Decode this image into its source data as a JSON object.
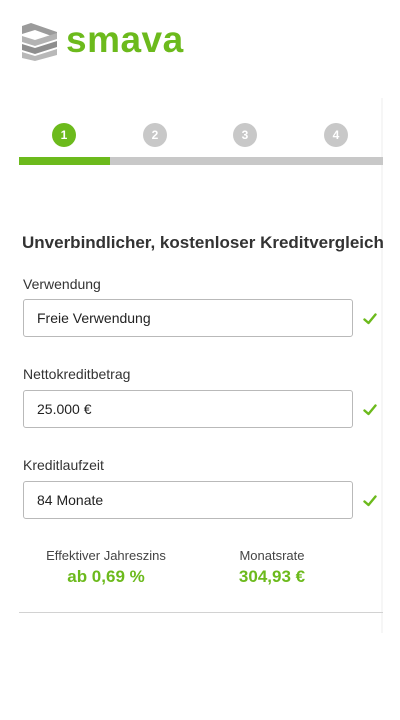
{
  "brand": {
    "name": "smava",
    "logo_icon": "smava-logo-icon",
    "color": "#6cba1c"
  },
  "steps": {
    "items": [
      {
        "number": "1",
        "active": true
      },
      {
        "number": "2",
        "active": false
      },
      {
        "number": "3",
        "active": false
      },
      {
        "number": "4",
        "active": false
      }
    ],
    "progress": 0.25
  },
  "form": {
    "heading": "Unverbindlicher, kostenloser Kreditvergleich",
    "fields": [
      {
        "label": "Verwendung",
        "value": "Freie Verwendung",
        "valid": true
      },
      {
        "label": "Nettokreditbetrag",
        "value": "25.000 €",
        "valid": true
      },
      {
        "label": "Kreditlaufzeit",
        "value": "84 Monate",
        "valid": true
      }
    ]
  },
  "summary": {
    "rate_label": "Effektiver Jahreszins",
    "rate_value": "ab 0,69 %",
    "monthly_label": "Monatsrate",
    "monthly_value": "304,93 €"
  },
  "colors": {
    "accent": "#6cba1c",
    "inactive": "#c8c8c8",
    "border": "#b9b9b9"
  }
}
